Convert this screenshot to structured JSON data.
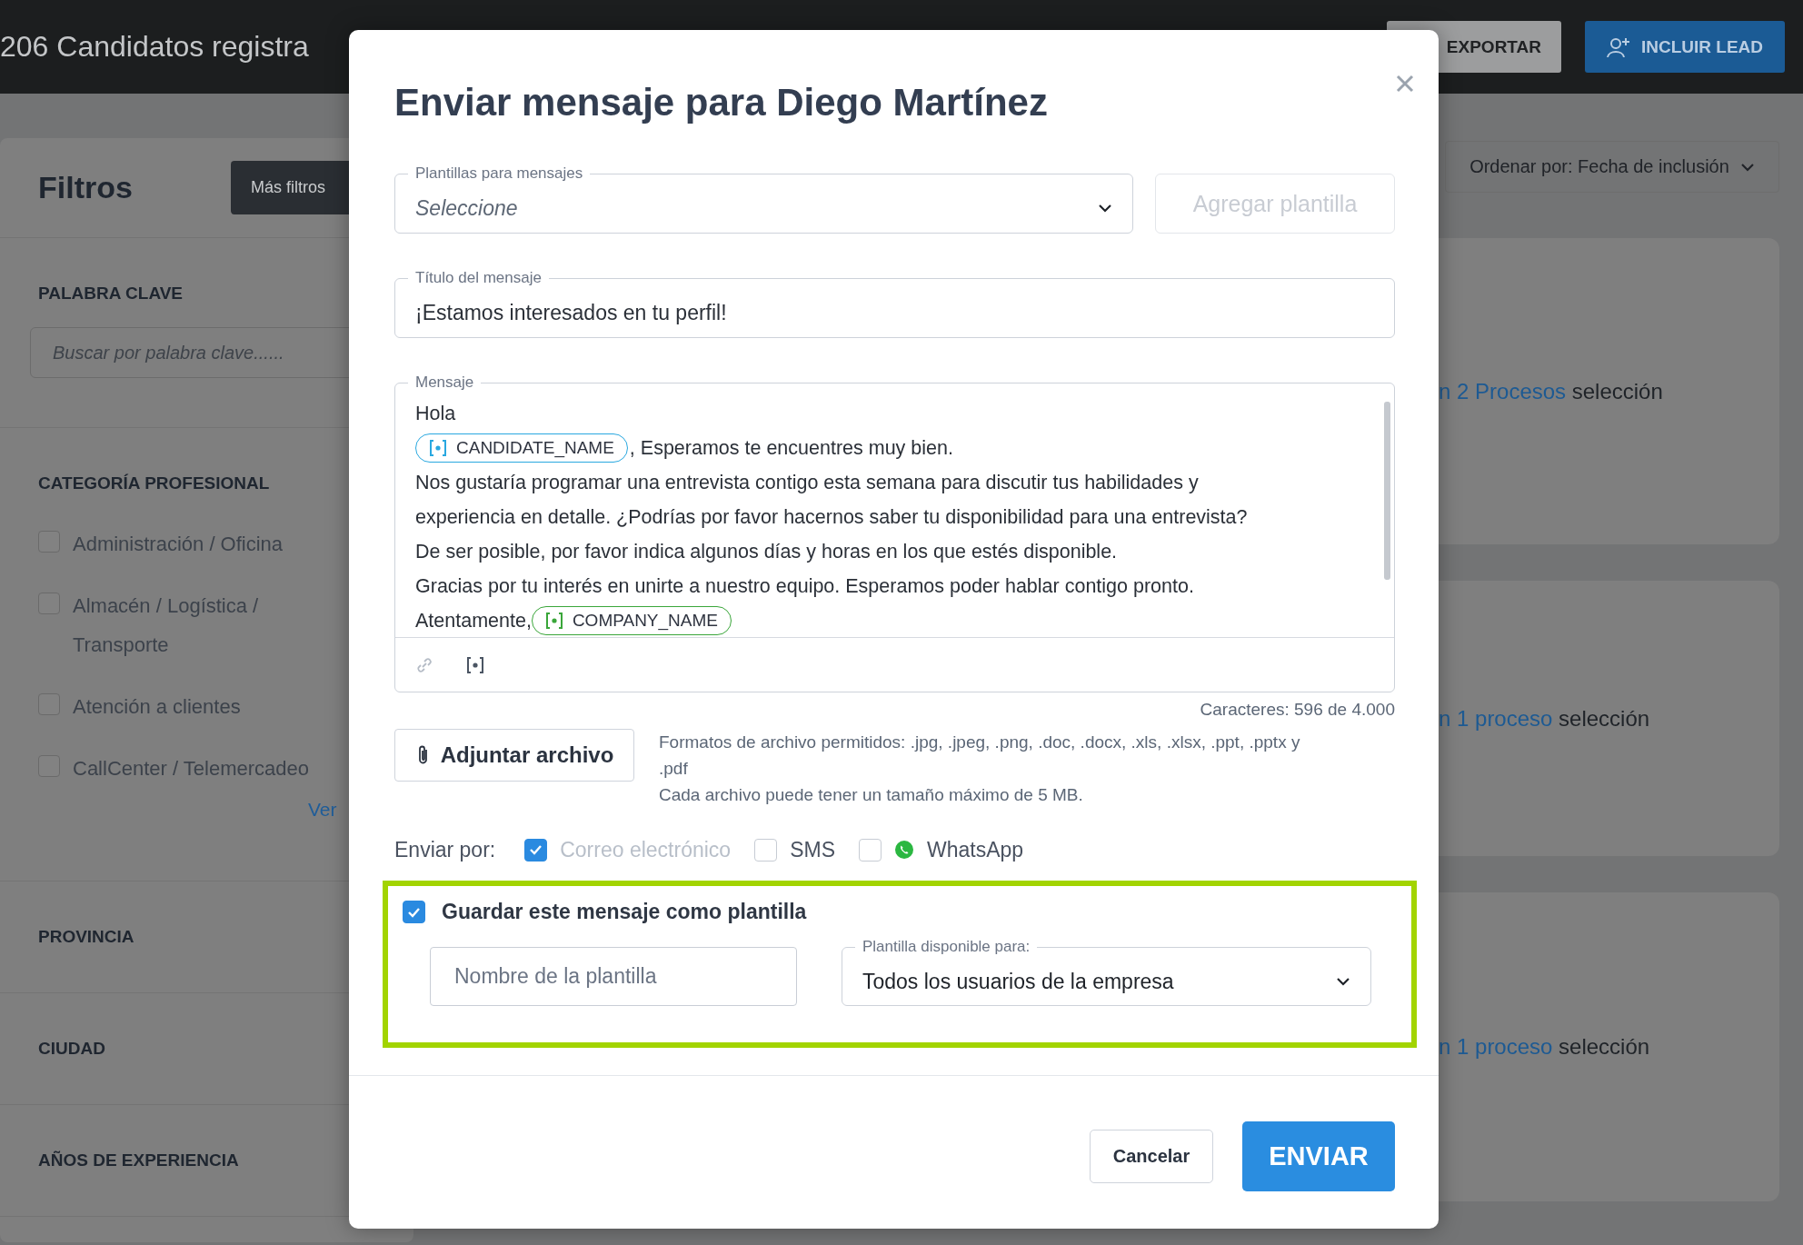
{
  "top_bar": {
    "title": "206 Candidatos registra",
    "buttons": [
      {
        "label": "EXPORTAR",
        "kind": "secondary"
      },
      {
        "label": "INCLUIR LEAD",
        "kind": "primary"
      }
    ]
  },
  "filters": {
    "title": "Filtros",
    "more_button": "Más filtros",
    "sections": [
      {
        "kind": "search",
        "heading": "PALABRA CLAVE",
        "placeholder": "Buscar por palabra clave......"
      },
      {
        "kind": "checklist",
        "heading": "CATEGORÍA PROFESIONAL",
        "items": [
          {
            "label": "Administración / Oficina",
            "checked": false
          },
          {
            "label": "Almacén / Logística / Transporte",
            "checked": false
          },
          {
            "label": "Atención a clientes",
            "checked": false
          },
          {
            "label": "CallCenter / Telemercadeo",
            "checked": false
          }
        ],
        "link": "Ver"
      },
      {
        "kind": "collapsed",
        "heading": "PROVINCIA"
      },
      {
        "kind": "collapsed",
        "heading": "CIUDAD"
      },
      {
        "kind": "collapsed",
        "heading": "AÑOS DE EXPERIENCIA"
      }
    ]
  },
  "sort": {
    "label": "Ordenar por: Fecha de inclusión"
  },
  "results": [
    {
      "link": "n 2 Procesos",
      "text": "selección"
    },
    {
      "link": "n 1 proceso",
      "text": "selección"
    },
    {
      "link": "n 1 proceso",
      "text": "selección"
    }
  ],
  "dialog": {
    "title": "Enviar mensaje para Diego Martínez",
    "template_select": {
      "label": "Plantillas para mensajes",
      "placeholder": "Seleccione"
    },
    "add_template_button": {
      "label": "Agregar plantilla",
      "disabled": true
    },
    "title_field": {
      "label": "Título del mensaje",
      "value": "¡Estamos interesados en tu perfil!"
    },
    "message": {
      "label": "Mensaje",
      "lines": [
        [
          {
            "kind": "text",
            "text": "Hola"
          }
        ],
        [
          {
            "kind": "variable",
            "text": "CANDIDATE_NAME",
            "color": "#29a8e0"
          },
          {
            "kind": "text",
            "text": ", Esperamos te encuentres muy bien."
          }
        ],
        [
          {
            "kind": "text",
            "text": "Nos gustaría programar una entrevista contigo esta semana para discutir tus habilidades y"
          }
        ],
        [
          {
            "kind": "text",
            "text": "experiencia en detalle. ¿Podrías por favor hacernos saber tu disponibilidad para una entrevista?"
          }
        ],
        [
          {
            "kind": "text",
            "text": "De ser posible, por favor indica algunos días y horas en los que estés disponible."
          }
        ],
        [
          {
            "kind": "text",
            "text": "Gracias por tu interés en unirte a nuestro equipo. Esperamos poder hablar contigo pronto."
          }
        ],
        [
          {
            "kind": "text",
            "text": "Atentamente,"
          },
          {
            "kind": "variable",
            "text": "COMPANY_NAME",
            "color": "#3aa63a"
          }
        ]
      ]
    },
    "char_count": "Caracteres: 596 de 4.000",
    "attach_button": "Adjuntar archivo",
    "attach_help": [
      "Formatos de archivo permitidos: .jpg, .jpeg, .png, .doc, .docx, .xls, .xlsx, .ppt, .pptx y .pdf",
      "Cada archivo puede tener un tamaño máximo de 5 MB."
    ],
    "send_via": {
      "label": "Enviar por:",
      "channels": [
        {
          "label": "Correo electrónico",
          "kind": "email",
          "checked": true,
          "disabled": true
        },
        {
          "label": "SMS",
          "kind": "sms",
          "checked": false,
          "disabled": false
        },
        {
          "label": "WhatsApp",
          "kind": "whatsapp",
          "checked": false,
          "disabled": false
        }
      ]
    },
    "save_template": {
      "label": "Guardar este mensaje como plantilla",
      "checked": true,
      "highlighted": true,
      "name_field": {
        "placeholder": "Nombre de la plantilla"
      },
      "availability": {
        "label": "Plantilla disponible para:",
        "value": "Todos los usuarios de la empresa"
      }
    },
    "buttons": [
      {
        "label": "Cancelar",
        "kind": "secondary"
      },
      {
        "label": "ENVIAR",
        "kind": "primary"
      }
    ]
  }
}
